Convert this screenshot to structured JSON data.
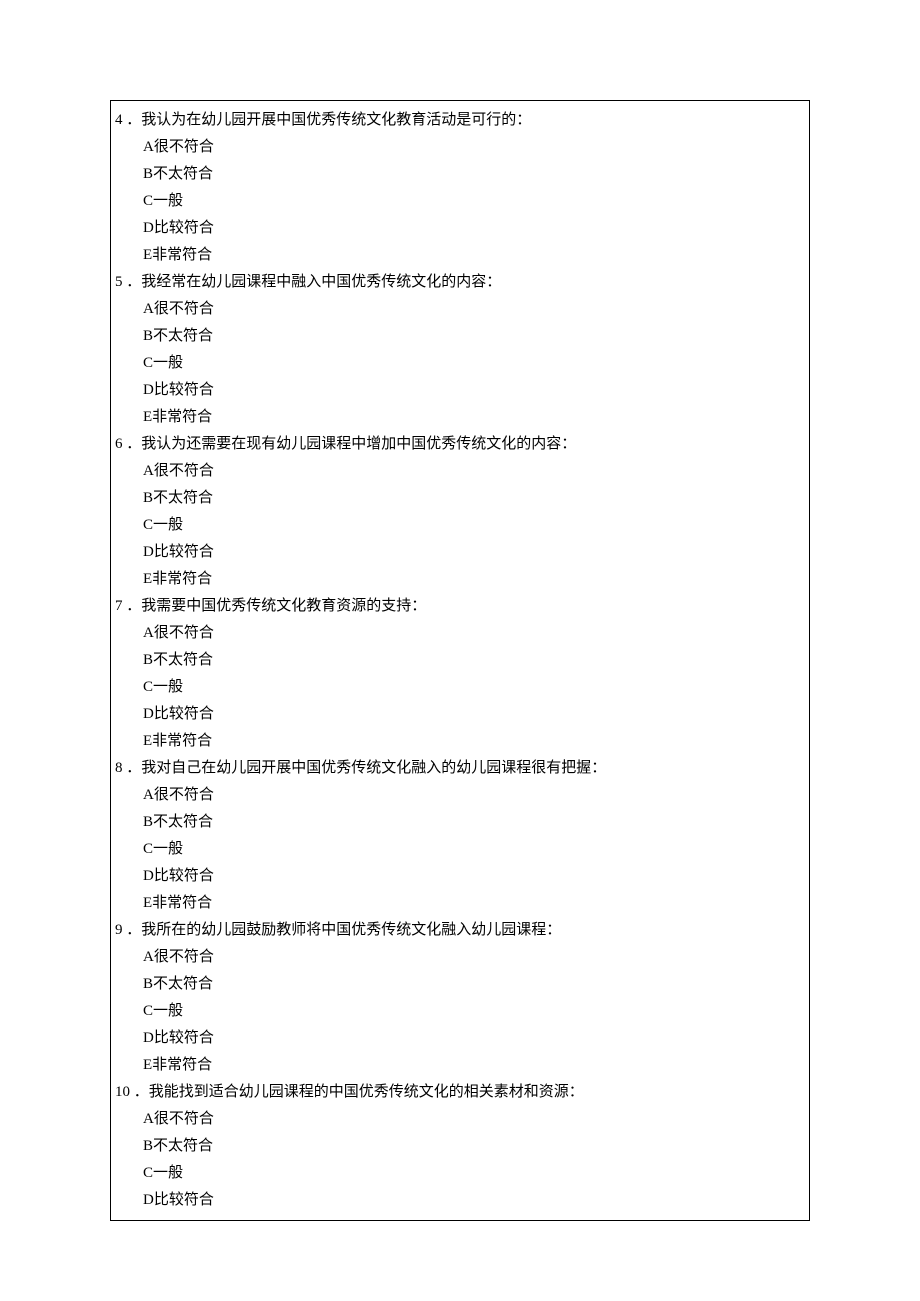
{
  "questions": [
    {
      "num": "4",
      "text": "．我认为在幼儿园开展中国优秀传统文化教育活动是可行的：",
      "options": [
        "A很不符合",
        "B不太符合",
        "C一般",
        "D比较符合",
        "E非常符合"
      ]
    },
    {
      "num": "5",
      "text": "．我经常在幼儿园课程中融入中国优秀传统文化的内容：",
      "options": [
        "A很不符合",
        "B不太符合",
        "C一般",
        "D比较符合",
        "E非常符合"
      ]
    },
    {
      "num": "6",
      "text": "．我认为还需要在现有幼儿园课程中增加中国优秀传统文化的内容：",
      "options": [
        "A很不符合",
        "B不太符合",
        "C一般",
        "D比较符合",
        "E非常符合"
      ]
    },
    {
      "num": "7",
      "text": "．我需要中国优秀传统文化教育资源的支持：",
      "options": [
        "A很不符合",
        "B不太符合",
        "C一般",
        "D比较符合",
        "E非常符合"
      ]
    },
    {
      "num": "8",
      "text": "．我对自己在幼儿园开展中国优秀传统文化融入的幼儿园课程很有把握：",
      "options": [
        "A很不符合",
        "B不太符合",
        "C一般",
        "D比较符合",
        "E非常符合"
      ]
    },
    {
      "num": "9",
      "text": "．我所在的幼儿园鼓励教师将中国优秀传统文化融入幼儿园课程：",
      "options": [
        "A很不符合",
        "B不太符合",
        "C一般",
        "D比较符合",
        "E非常符合"
      ]
    },
    {
      "num": "10",
      "text": "．我能找到适合幼儿园课程的中国优秀传统文化的相关素材和资源：",
      "options": [
        "A很不符合",
        "B不太符合",
        "C一般",
        "D比较符合"
      ]
    }
  ]
}
